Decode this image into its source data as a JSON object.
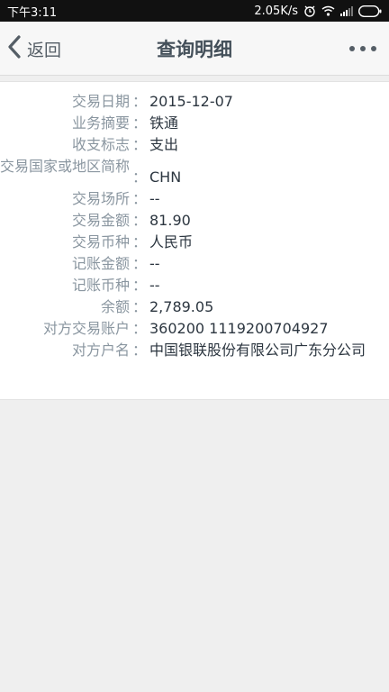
{
  "status": {
    "time": "下午3:11",
    "speed": "2.05K/s"
  },
  "nav": {
    "back_label": "返回",
    "title": "查询明细"
  },
  "details": [
    {
      "label": "交易日期",
      "value": "2015-12-07"
    },
    {
      "label": "业务摘要",
      "value": "铁通"
    },
    {
      "label": "收支标志",
      "value": "支出"
    },
    {
      "label": "交易国家或地区简称",
      "value": "CHN"
    },
    {
      "label": "交易场所",
      "value": "--"
    },
    {
      "label": "交易金额",
      "value": "81.90"
    },
    {
      "label": "交易币种",
      "value": "人民币"
    },
    {
      "label": "记账金额",
      "value": "--"
    },
    {
      "label": "记账币种",
      "value": "--"
    },
    {
      "label": "余额",
      "value": "2,789.05"
    },
    {
      "label": "对方交易账户",
      "value": "360200 1119200704927"
    },
    {
      "label": "对方户名",
      "value": "中国银联股份有限公司广东分公司"
    }
  ],
  "colon": "："
}
